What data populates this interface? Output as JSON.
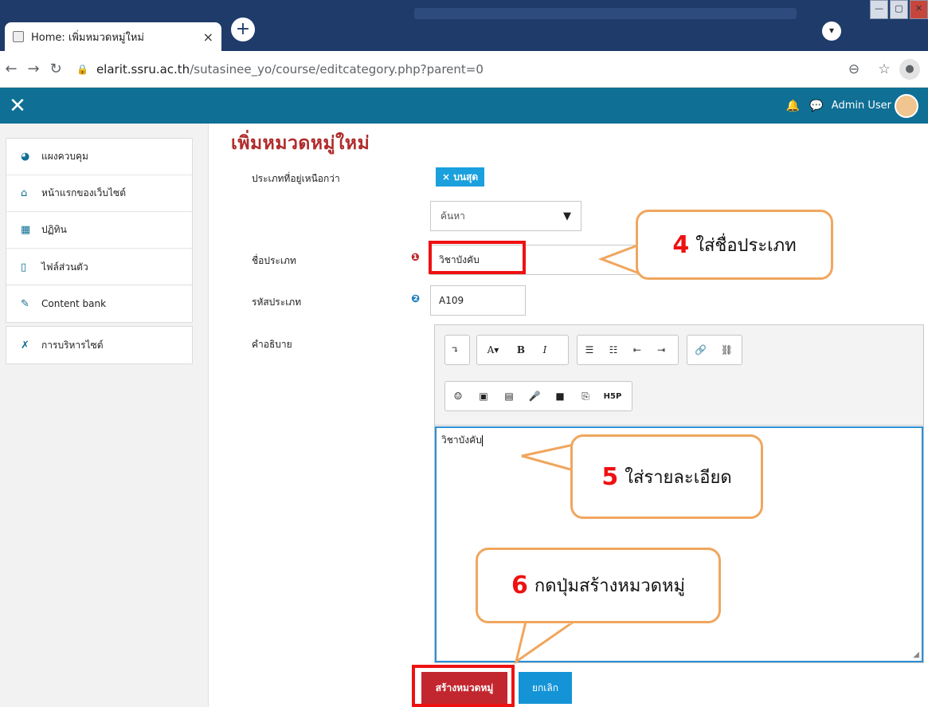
{
  "browser": {
    "tab_title": "Home: เพิ่มหมวดหมู่ใหม่",
    "tab_close": "×",
    "new_tab": "+",
    "url_domain": "elarit.ssru.ac.th",
    "url_path": "/sutasinee_yo/course/editcategory.php?parent=0",
    "window_controls": [
      "—",
      "▢",
      "✕"
    ]
  },
  "navbar": {
    "user_name": "Admin User",
    "close_symbol": "✕"
  },
  "drawer": {
    "items": [
      {
        "label": "แผงควบคุม",
        "icon": "dashboard-icon",
        "glyph": "◕"
      },
      {
        "label": "หน้าแรกของเว็บไซต์",
        "icon": "home-icon",
        "glyph": "⌂"
      },
      {
        "label": "ปฏิทิน",
        "icon": "calendar-icon",
        "glyph": "▦"
      },
      {
        "label": "ไฟล์ส่วนตัว",
        "icon": "file-icon",
        "glyph": "▯"
      },
      {
        "label": "Content bank",
        "icon": "paintbrush-icon",
        "glyph": "✎"
      },
      {
        "label": "การบริหารไซต์",
        "icon": "wrench-icon",
        "glyph": "✗"
      }
    ]
  },
  "form": {
    "title": "เพิ่มหมวดหมู่ใหม่",
    "parent_label": "ประเภทที่อยู่เหนือกว่า",
    "parent_value": "× บนสุด",
    "search_placeholder": "ค้นหา",
    "name_label": "ชื่อประเภท",
    "name_value": "วิชาบังคับ",
    "idnumber_label": "รหัสประเภท",
    "idnumber_value": "A109",
    "description_label": "คำอธิบาย",
    "description_value": "วิชาบังคับ",
    "submit_label": "สร้างหมวดหมู่",
    "cancel_label": "ยกเลิก"
  },
  "editor_toolbar": {
    "row1": [
      "↴",
      "A▾",
      "B",
      "I",
      "☰",
      "☷",
      "⇤",
      "⇥",
      "🔗",
      "⛓"
    ],
    "row2": [
      "☺",
      "▣",
      "▤",
      "🎤",
      "■",
      "⎘",
      "H5P"
    ]
  },
  "annotations": [
    {
      "number": "4",
      "text": "ใส่ชื่อประเภท"
    },
    {
      "number": "5",
      "text": "ใส่รายละเอียด"
    },
    {
      "number": "6",
      "text": "กดปุ่มสร้างหมวดหมู่"
    }
  ],
  "colors": {
    "navbar": "#0f6f95",
    "title": "#b02c2c",
    "primary_button": "#c2272f",
    "secondary_button": "#1494d6",
    "annotation_border": "#f0a65e",
    "highlight_red": "#e11111"
  }
}
